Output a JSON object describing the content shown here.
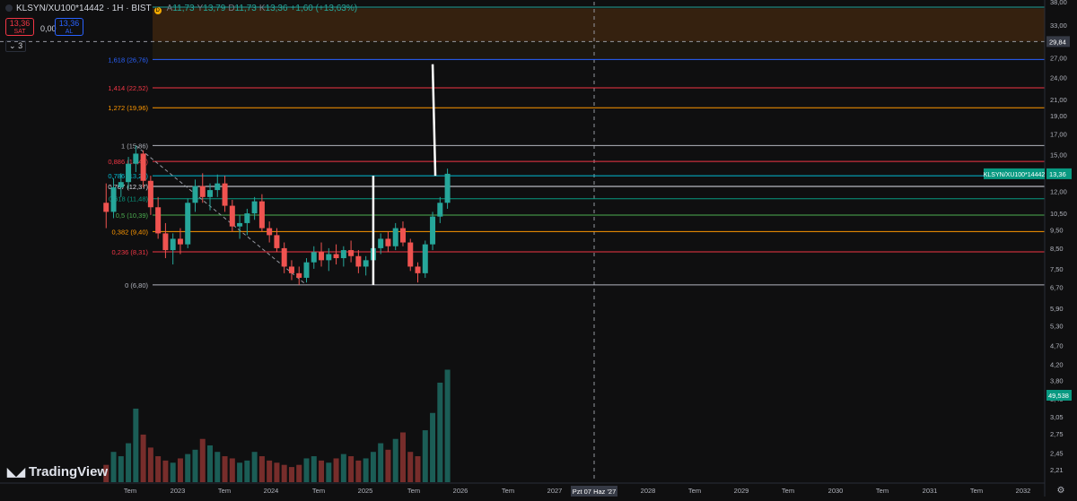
{
  "header": {
    "symbol": "KLSYN/XU100*14442 · 1H · BIST",
    "open_label": "A",
    "open": "11,73",
    "high_label": "Y",
    "high": "13,79",
    "low_label": "D",
    "low": "11,73",
    "close_label": "K",
    "close": "13,36",
    "change": "+1,60 (+13,63%)"
  },
  "trade": {
    "sell_price": "13,36",
    "sell_label": "SAT",
    "spread": "0,00",
    "buy_price": "13,36",
    "buy_label": "AL"
  },
  "collapse_label": "3",
  "logo_text": "TradingView",
  "icons": {
    "logo": "tradingview-logo-icon",
    "collapse": "chevron-down-icon",
    "settings": "gear-icon"
  },
  "colors": {
    "up": "#26a69a",
    "down": "#ef5350",
    "background": "#0f0f10",
    "price_badge": "#089981"
  },
  "chart_data": {
    "type": "candlestick",
    "price_scale": "log",
    "ylim": [
      2.05,
      38.0
    ],
    "y_ticks": [
      "38,00",
      "33,00",
      "27,00",
      "24,00",
      "21,00",
      "19,00",
      "17,00",
      "15,00",
      "13,50",
      "12,00",
      "10,50",
      "9,50",
      "8,50",
      "7,50",
      "6,70",
      "5,90",
      "5,30",
      "4,70",
      "4,20",
      "3,80",
      "3,40",
      "3,05",
      "2,75",
      "2,45",
      "2,21"
    ],
    "x_ticks": [
      "Tem",
      "2023",
      "Tem",
      "2024",
      "Tem",
      "2025",
      "Tem",
      "2026",
      "Tem",
      "2027",
      "Tem",
      "2028",
      "Tem",
      "2029",
      "Tem",
      "2030",
      "Tem",
      "2031",
      "Tem",
      "2032"
    ],
    "x_range": [
      "2022-05",
      "2032-12"
    ],
    "crosshair": {
      "x_label": "Pzt 07 Haz '27",
      "y_label": "29,84"
    },
    "last_price": {
      "symbol": "KLSYN/XU100*14442",
      "value": "13,36"
    },
    "volume_label": "49,538",
    "fibonacci": [
      {
        "label": "0 (6,80)",
        "level": 6.8,
        "color": "#b2b5be"
      },
      {
        "label": "0,236 (8,31)",
        "level": 8.31,
        "color": "#f23645"
      },
      {
        "label": "0,382 (9,40)",
        "level": 9.4,
        "color": "#ff9800"
      },
      {
        "label": "0,5 (10,39)",
        "level": 10.39,
        "color": "#4caf50"
      },
      {
        "label": "0,618 (11,48)",
        "level": 11.48,
        "color": "#089981"
      },
      {
        "label": "0,707 (12,37)",
        "level": 12.37,
        "color": "#e0e3eb"
      },
      {
        "label": "0,786 (13,20)",
        "level": 13.2,
        "color": "#00bcd4"
      },
      {
        "label": "0,886 (14,40)",
        "level": 14.4,
        "color": "#f23645"
      },
      {
        "label": "1 (15,86)",
        "level": 15.86,
        "color": "#b2b5be"
      },
      {
        "label": "1,272 (19,96)",
        "level": 19.96,
        "color": "#ff9800"
      },
      {
        "label": "1,414 (22,52)",
        "level": 22.52,
        "color": "#f23645"
      },
      {
        "label": "1,618 (26,76)",
        "level": 26.76,
        "color": "#2962ff"
      }
    ],
    "zones": [
      {
        "from": 29.84,
        "to": 36.5,
        "color": "#3a2410"
      },
      {
        "from": 26.76,
        "to": 29.84,
        "color": "#1f1a10"
      }
    ],
    "trendline": {
      "from": [
        "2022-10",
        15.86
      ],
      "to": [
        "2024-09",
        6.8
      ]
    },
    "drawings": [
      {
        "type": "vertical-line",
        "x": "2025-06",
        "from": 6.8,
        "to": 13.2,
        "color": "#ffffff"
      },
      {
        "type": "vertical-line",
        "x": "2026-02",
        "from": 13.2,
        "to": 26.0,
        "color": "#ffffff"
      }
    ],
    "candles": [
      {
        "t": "2022-06",
        "o": 11.2,
        "h": 12.6,
        "l": 9.6,
        "c": 10.6
      },
      {
        "t": "2022-07",
        "o": 10.6,
        "h": 13.0,
        "l": 10.2,
        "c": 12.3
      },
      {
        "t": "2022-08",
        "o": 12.3,
        "h": 13.4,
        "l": 11.6,
        "c": 12.7
      },
      {
        "t": "2022-09",
        "o": 12.7,
        "h": 14.8,
        "l": 12.2,
        "c": 14.2
      },
      {
        "t": "2022-10",
        "o": 14.2,
        "h": 15.86,
        "l": 13.5,
        "c": 15.1
      },
      {
        "t": "2022-11",
        "o": 15.1,
        "h": 15.4,
        "l": 12.3,
        "c": 12.8
      },
      {
        "t": "2022-12",
        "o": 12.8,
        "h": 13.2,
        "l": 10.4,
        "c": 10.9
      },
      {
        "t": "2023-01",
        "o": 10.9,
        "h": 11.6,
        "l": 9.0,
        "c": 9.3
      },
      {
        "t": "2023-02",
        "o": 9.3,
        "h": 9.9,
        "l": 8.0,
        "c": 8.4
      },
      {
        "t": "2023-03",
        "o": 8.4,
        "h": 9.3,
        "l": 7.7,
        "c": 9.0
      },
      {
        "t": "2023-04",
        "o": 9.0,
        "h": 9.6,
        "l": 8.2,
        "c": 8.7
      },
      {
        "t": "2023-05",
        "o": 8.7,
        "h": 11.5,
        "l": 8.5,
        "c": 11.2
      },
      {
        "t": "2023-06",
        "o": 11.2,
        "h": 12.9,
        "l": 10.6,
        "c": 12.4
      },
      {
        "t": "2023-07",
        "o": 12.4,
        "h": 13.4,
        "l": 11.2,
        "c": 11.6
      },
      {
        "t": "2023-08",
        "o": 11.6,
        "h": 12.6,
        "l": 10.7,
        "c": 12.1
      },
      {
        "t": "2023-09",
        "o": 12.1,
        "h": 13.3,
        "l": 11.6,
        "c": 12.6
      },
      {
        "t": "2023-10",
        "o": 12.6,
        "h": 13.2,
        "l": 10.6,
        "c": 11.0
      },
      {
        "t": "2023-11",
        "o": 11.0,
        "h": 11.4,
        "l": 9.4,
        "c": 9.7
      },
      {
        "t": "2023-12",
        "o": 9.7,
        "h": 10.4,
        "l": 9.0,
        "c": 9.9
      },
      {
        "t": "2024-01",
        "o": 9.9,
        "h": 10.8,
        "l": 9.2,
        "c": 10.5
      },
      {
        "t": "2024-02",
        "o": 10.5,
        "h": 11.6,
        "l": 10.1,
        "c": 11.3
      },
      {
        "t": "2024-03",
        "o": 11.3,
        "h": 11.8,
        "l": 9.4,
        "c": 9.6
      },
      {
        "t": "2024-04",
        "o": 9.6,
        "h": 10.0,
        "l": 8.8,
        "c": 9.2
      },
      {
        "t": "2024-05",
        "o": 9.2,
        "h": 9.6,
        "l": 8.3,
        "c": 8.5
      },
      {
        "t": "2024-06",
        "o": 8.5,
        "h": 8.8,
        "l": 7.3,
        "c": 7.6
      },
      {
        "t": "2024-07",
        "o": 7.6,
        "h": 7.9,
        "l": 7.0,
        "c": 7.3
      },
      {
        "t": "2024-08",
        "o": 7.3,
        "h": 7.6,
        "l": 6.8,
        "c": 7.1
      },
      {
        "t": "2024-09",
        "o": 7.1,
        "h": 8.0,
        "l": 6.9,
        "c": 7.8
      },
      {
        "t": "2024-10",
        "o": 7.8,
        "h": 8.6,
        "l": 7.5,
        "c": 8.3
      },
      {
        "t": "2024-11",
        "o": 8.3,
        "h": 8.8,
        "l": 7.6,
        "c": 7.9
      },
      {
        "t": "2024-12",
        "o": 7.9,
        "h": 8.5,
        "l": 7.4,
        "c": 8.2
      },
      {
        "t": "2025-01",
        "o": 8.2,
        "h": 8.7,
        "l": 7.7,
        "c": 8.0
      },
      {
        "t": "2025-02",
        "o": 8.0,
        "h": 8.6,
        "l": 7.6,
        "c": 8.4
      },
      {
        "t": "2025-03",
        "o": 8.4,
        "h": 8.9,
        "l": 7.8,
        "c": 8.1
      },
      {
        "t": "2025-04",
        "o": 8.1,
        "h": 8.4,
        "l": 7.3,
        "c": 7.6
      },
      {
        "t": "2025-05",
        "o": 7.6,
        "h": 8.1,
        "l": 7.2,
        "c": 7.9
      },
      {
        "t": "2025-06",
        "o": 7.9,
        "h": 8.8,
        "l": 7.6,
        "c": 8.5
      },
      {
        "t": "2025-07",
        "o": 8.5,
        "h": 9.3,
        "l": 8.2,
        "c": 9.0
      },
      {
        "t": "2025-08",
        "o": 9.0,
        "h": 9.4,
        "l": 8.3,
        "c": 8.6
      },
      {
        "t": "2025-09",
        "o": 8.6,
        "h": 9.9,
        "l": 8.4,
        "c": 9.6
      },
      {
        "t": "2025-10",
        "o": 9.6,
        "h": 10.0,
        "l": 8.6,
        "c": 8.8
      },
      {
        "t": "2025-11",
        "o": 8.8,
        "h": 9.0,
        "l": 7.4,
        "c": 7.6
      },
      {
        "t": "2025-12",
        "o": 7.6,
        "h": 7.8,
        "l": 6.9,
        "c": 7.3
      },
      {
        "t": "2026-01",
        "o": 7.3,
        "h": 8.9,
        "l": 7.1,
        "c": 8.7
      },
      {
        "t": "2026-02",
        "o": 8.7,
        "h": 10.6,
        "l": 8.4,
        "c": 10.3
      },
      {
        "t": "2026-03",
        "o": 10.3,
        "h": 11.6,
        "l": 9.9,
        "c": 11.2
      },
      {
        "t": "2026-04",
        "o": 11.2,
        "h": 13.79,
        "l": 10.8,
        "c": 13.36
      }
    ],
    "volumes": [
      8,
      14,
      12,
      18,
      34,
      22,
      16,
      12,
      10,
      9,
      11,
      13,
      15,
      20,
      17,
      14,
      12,
      11,
      9,
      10,
      14,
      12,
      10,
      9,
      8,
      7,
      8,
      11,
      12,
      10,
      9,
      11,
      13,
      12,
      10,
      11,
      14,
      18,
      15,
      20,
      23,
      14,
      12,
      24,
      32,
      46,
      52,
      58
    ]
  }
}
